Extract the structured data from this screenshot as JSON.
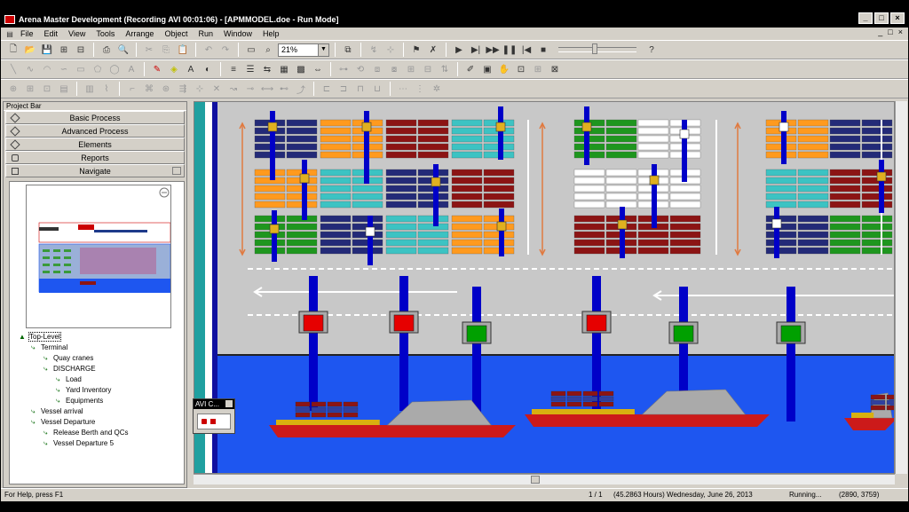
{
  "window": {
    "title": "Arena Master Development (Recording AVI 00:01:06) - [APMMODEL.doe - Run Mode]",
    "controls": [
      "_",
      "□",
      "×"
    ]
  },
  "menu": [
    "File",
    "Edit",
    "View",
    "Tools",
    "Arrange",
    "Object",
    "Run",
    "Window",
    "Help"
  ],
  "mdi_controls": [
    "_",
    "□",
    "×"
  ],
  "toolbar": {
    "zoom": "21%"
  },
  "project_bar": {
    "title": "Project Bar",
    "panels": [
      "Basic Process",
      "Advanced Process",
      "Elements",
      "Reports",
      "Navigate"
    ]
  },
  "tree": [
    {
      "label": "Top-Level",
      "level": 0
    },
    {
      "label": "Terminal",
      "level": 1
    },
    {
      "label": "Quay cranes",
      "level": 2
    },
    {
      "label": "DISCHARGE",
      "level": 2
    },
    {
      "label": "Load",
      "level": 3
    },
    {
      "label": "Yard Inventory",
      "level": 3
    },
    {
      "label": "Equipments",
      "level": 3
    },
    {
      "label": "Vessel arrival",
      "level": 1
    },
    {
      "label": "Vessel Departure",
      "level": 1
    },
    {
      "label": "Release Berth and QCs",
      "level": 2
    },
    {
      "label": "Vessel Departure   5",
      "level": 2
    }
  ],
  "avi": {
    "title": "AVI C..."
  },
  "status": {
    "help": "For Help, press F1",
    "page": "1 / 1",
    "time": "(45.2863 Hours) Wednesday, June 26, 2013",
    "state": "Running...",
    "coords": "(2890, 3759)"
  },
  "colors": {
    "water": "#1e56f0",
    "yard": "#c8c8c8",
    "crane": "#0000c8",
    "crane_busy": "#e60000",
    "crane_idle": "#00a000",
    "container_orange": "#ff9a1e",
    "container_navy": "#232a78",
    "container_red": "#8c1414",
    "container_teal": "#3cc3c3",
    "container_green": "#1e961e",
    "container_white": "#ffffff"
  }
}
